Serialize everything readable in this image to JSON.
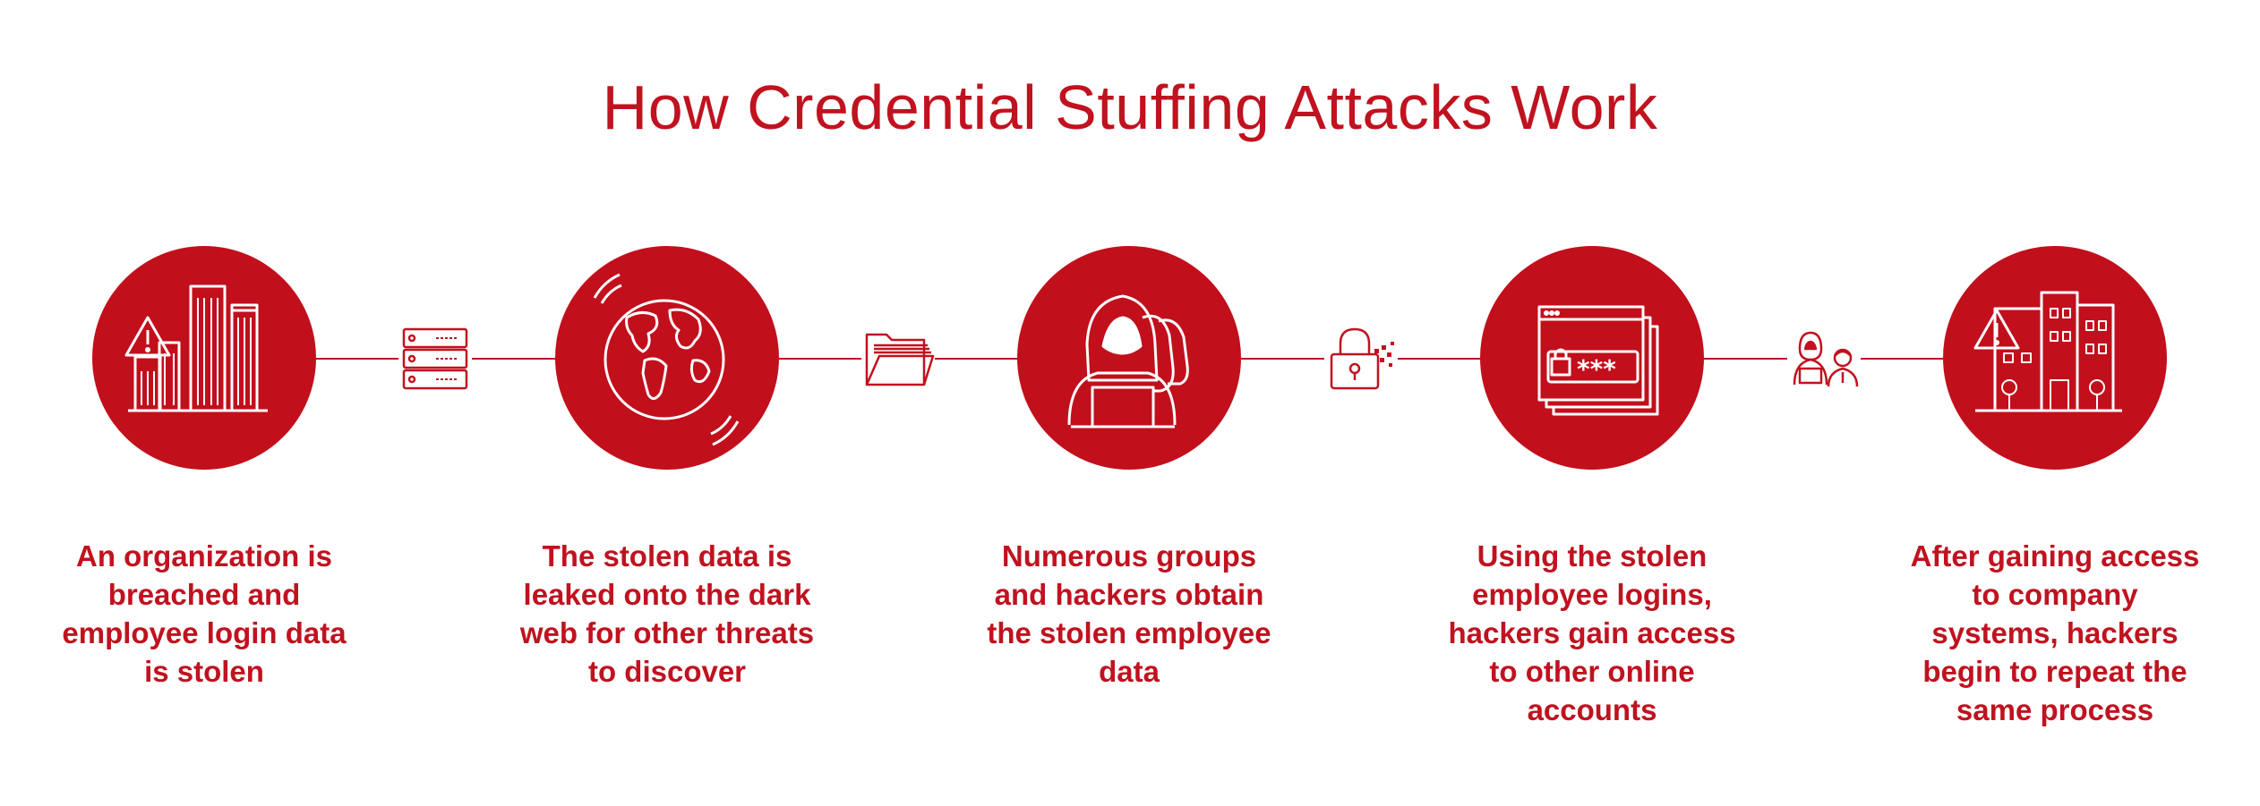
{
  "title": "How Credential Stuffing Attacks Work",
  "colors": {
    "accent": "#c20f1c",
    "icon_line": "#ffffff",
    "background": "#ffffff"
  },
  "steps": [
    {
      "icon": "breached-buildings-icon",
      "caption": "An organization is breached and employee login data is stolen"
    },
    {
      "icon": "globe-broadcast-icon",
      "caption": "The stolen data is leaked onto the dark web for other threats to discover"
    },
    {
      "icon": "hooded-hackers-icon",
      "caption": "Numerous groups and hackers obtain the stolen employee data"
    },
    {
      "icon": "password-login-window-icon",
      "caption": "Using the stolen employee logins, hackers gain access to other online accounts"
    },
    {
      "icon": "breached-buildings-icon",
      "caption": "After gaining access to company systems, hackers begin to repeat the same process"
    }
  ],
  "connectors": [
    {
      "icon": "server-rack-icon"
    },
    {
      "icon": "open-folder-icon"
    },
    {
      "icon": "broken-padlock-icon"
    },
    {
      "icon": "hacker-and-employee-icon"
    }
  ]
}
